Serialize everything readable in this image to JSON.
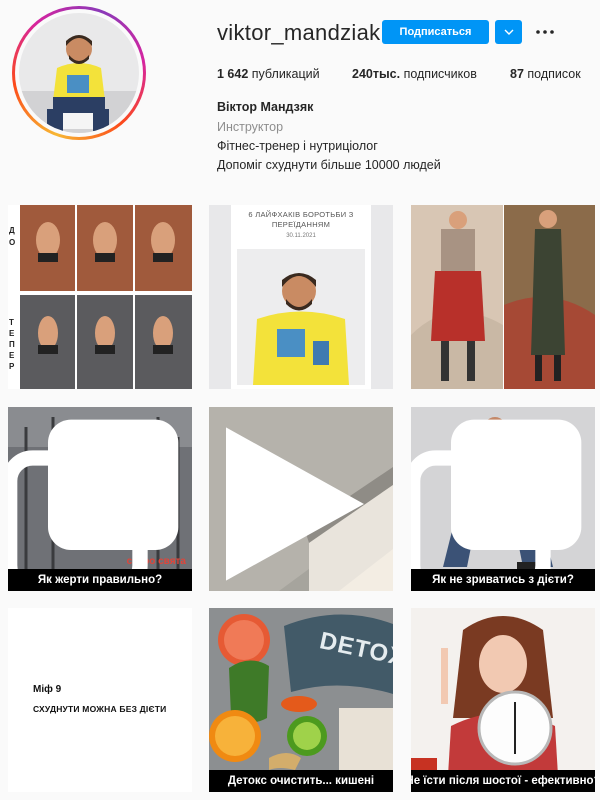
{
  "profile": {
    "username": "viktor_mandziak",
    "follow_label": "Подписаться",
    "posts_count": "1 642",
    "posts_label": "публикаций",
    "followers_count": "240тыс.",
    "followers_label": "подписчиков",
    "following_count": "87",
    "following_label": "подписок",
    "full_name": "Віктор Мандзяк",
    "category": "Инструктор",
    "bio_line1": "Фітнес-тренер і нутриціолог",
    "bio_line2": "Допоміг схуднути більше 10000 людей"
  },
  "icons": {
    "dropdown": "chevron-down-icon",
    "more": "more-options-icon",
    "carousel": "carousel-icon",
    "video": "video-play-icon"
  },
  "colors": {
    "follow_button": "#0095f6"
  },
  "posts": [
    {
      "side_top": "ДО",
      "side_bottom": "ТЕПЕР"
    },
    {
      "title": "6 ЛАЙФХАКІВ БОРОТЬБИ З ПЕРЕЇДАННЯМ",
      "date": "30.11.2021"
    },
    {},
    {
      "caption": "Як жерти правильно?",
      "overlay": "скоро свята"
    },
    {},
    {
      "caption": "Як не зриватись з дієти?"
    },
    {
      "line1": "Міф 9",
      "line2": "СХУДНУТИ МОЖНА БЕЗ ДІЄТИ"
    },
    {
      "sign": "DETOX",
      "caption": "Детокс очистить... кишені"
    },
    {
      "caption": "Не їсти після шостої - ефективно?"
    }
  ]
}
